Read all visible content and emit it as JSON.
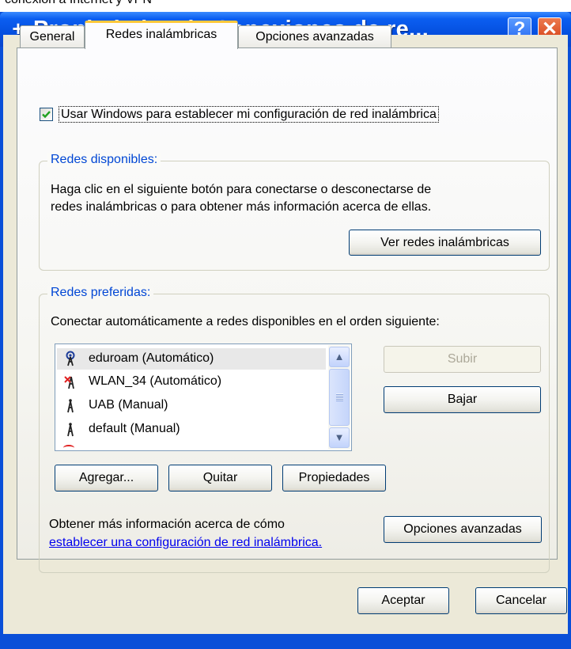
{
  "clipped_top_text": "conexión a Internet y VPN",
  "window": {
    "title": "Propiedades de Conexiones de re...",
    "help_label": "?",
    "close_label": "✕"
  },
  "tabs": [
    {
      "label": "General"
    },
    {
      "label": "Redes inalámbricas",
      "active": true
    },
    {
      "label": "Opciones avanzadas"
    }
  ],
  "use_windows_checkbox": {
    "checked": true,
    "label": "Usar Windows para establecer mi configuración de red inalámbrica"
  },
  "available_networks": {
    "title": "Redes disponibles:",
    "description_line1": "Haga clic en el siguiente botón para conectarse o desconectarse de",
    "description_line2": "redes inalámbricas o para obtener más información acerca de ellas.",
    "view_button": "Ver redes inalámbricas"
  },
  "preferred_networks": {
    "title": "Redes preferidas:",
    "description": "Conectar automáticamente a redes disponibles en el orden siguiente:",
    "items": [
      {
        "label": "eduroam (Automático)",
        "icon": "antenna-active-icon",
        "selected": true
      },
      {
        "label": "WLAN_34 (Automático)",
        "icon": "antenna-error-icon"
      },
      {
        "label": "UAB (Manual)",
        "icon": "antenna-icon"
      },
      {
        "label": "default (Manual)",
        "icon": "antenna-icon"
      }
    ],
    "move_up_button": "Subir",
    "move_down_button": "Bajar",
    "add_button": "Agregar...",
    "remove_button": "Quitar",
    "properties_button": "Propiedades",
    "info_text": "Obtener más información acerca de cómo",
    "info_link": "establecer una configuración de red inalámbrica.",
    "advanced_button": "Opciones avanzadas"
  },
  "footer": {
    "ok_button": "Aceptar",
    "cancel_button": "Cancelar"
  },
  "colors": {
    "titlebar": "#0550e0",
    "dialog_bg": "#ece9d8",
    "group_title": "#0046d5",
    "link": "#0000ee",
    "active_tab_accent": "#ffc83c"
  }
}
